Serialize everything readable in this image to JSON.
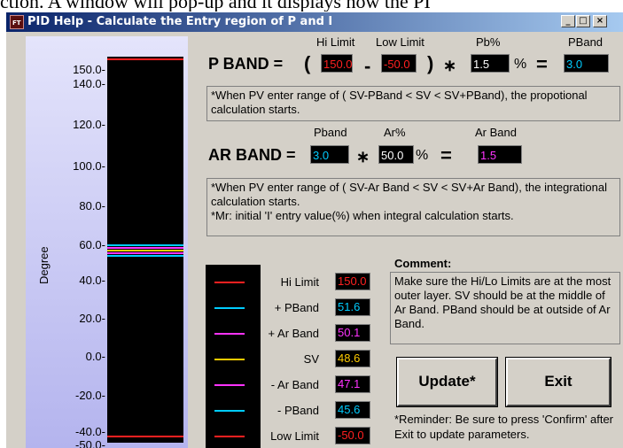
{
  "top_text": "ction. A window will pop-up and it displays how the PI",
  "window": {
    "title": "PID Help - Calculate the Entry region of P and I",
    "buttons": {
      "minimize": "_",
      "maximize": "□",
      "close": "×"
    }
  },
  "gauge": {
    "axis_label": "Degree",
    "ticks": [
      "150.0-",
      "140.0-",
      "120.0-",
      "100.0-",
      "80.0-",
      "60.0-",
      "40.0-",
      "20.0-",
      "0.0-",
      "-20.0-",
      "-40.0-",
      "-50.0-"
    ],
    "lines": [
      {
        "name": "hi-limit",
        "value": 150.0,
        "color": "#ff2020"
      },
      {
        "name": "pband-plus",
        "value": 51.6,
        "color": "#00ccff"
      },
      {
        "name": "arband-plus",
        "value": 50.1,
        "color": "#ff33ff"
      },
      {
        "name": "sv",
        "value": 48.6,
        "color": "#ffcc00"
      },
      {
        "name": "arband-minus",
        "value": 47.1,
        "color": "#ff33ff"
      },
      {
        "name": "pband-minus",
        "value": 45.6,
        "color": "#00ccff"
      },
      {
        "name": "low-limit",
        "value": -50.0,
        "color": "#ff2020"
      }
    ]
  },
  "pband": {
    "label": "P BAND =",
    "open_paren": "(",
    "minus": "-",
    "close_paren": ")",
    "times": "∗",
    "percent": "%",
    "equals": "=",
    "hi_limit_header": "Hi Limit",
    "low_limit_header": "Low Limit",
    "pb_header": "Pb%",
    "pband_header": "PBand",
    "hi_limit_value": "150.0",
    "low_limit_value": "-50.0",
    "pb_value": "1.5",
    "pband_value": "3.0",
    "note": "*When PV enter range of ( SV-PBand  < SV < SV+PBand), the propotional calculation starts."
  },
  "arband": {
    "label": "AR BAND =",
    "times": "∗",
    "percent": "%",
    "equals": "=",
    "pband_header": "Pband",
    "ar_header": "Ar%",
    "arband_header": "Ar Band",
    "pband_value": "3.0",
    "ar_value": "50.0",
    "arband_value": "1.5",
    "note_line1": "*When PV enter range of ( SV-Ar Band  < SV < SV+Ar Band), the integrational calculation starts.",
    "note_line2": "*Mr: initial 'I' entry value(%) when integral calculation starts."
  },
  "legend": {
    "items": [
      {
        "label": "Hi Limit",
        "value": "150.0",
        "value_color": "#ff2020",
        "line_color": "#ff2020"
      },
      {
        "label": "+ PBand",
        "value": "51.6",
        "value_color": "#00ccff",
        "line_color": "#00ccff"
      },
      {
        "label": "+ Ar Band",
        "value": "50.1",
        "value_color": "#ff33ff",
        "line_color": "#ff33ff"
      },
      {
        "label": "SV",
        "value": "48.6",
        "value_color": "#ffcc00",
        "line_color": "#ffcc00"
      },
      {
        "label": "- Ar Band",
        "value": "47.1",
        "value_color": "#ff33ff",
        "line_color": "#ff33ff"
      },
      {
        "label": "- PBand",
        "value": "45.6",
        "value_color": "#00ccff",
        "line_color": "#00ccff"
      },
      {
        "label": "Low Limit",
        "value": "-50.0",
        "value_color": "#ff2020",
        "line_color": "#ff2020"
      }
    ]
  },
  "comment": {
    "heading": "Comment:",
    "text": "Make sure the  Hi/Lo Limits are at the most outer layer. SV should be at the middle of Ar Band.  PBand should be at outside of Ar Band."
  },
  "actions": {
    "update_label": "Update*",
    "exit_label": "Exit",
    "reminder": "*Reminder: Be sure to press 'Confirm' after Exit to update parameters."
  },
  "colors": {
    "red": "#ff2020",
    "cyan": "#00ccff",
    "magenta": "#ff33ff",
    "yellow": "#ffcc00",
    "white": "#ffffff"
  }
}
